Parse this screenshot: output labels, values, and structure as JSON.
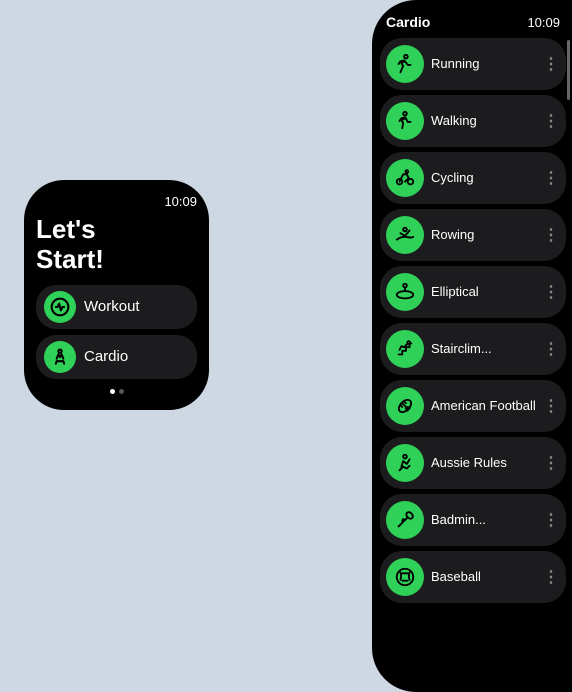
{
  "background_color": "#cdd8e3",
  "small_watch": {
    "time": "10:09",
    "title": "Let's\nStart!",
    "menu_items": [
      {
        "id": "workout",
        "label": "Workout",
        "icon": "🏋️"
      },
      {
        "id": "cardio",
        "label": "Cardio",
        "icon": "🏃"
      }
    ],
    "dots": [
      true,
      false
    ]
  },
  "large_watch": {
    "header_title": "Cardio",
    "time": "10:09",
    "list_items": [
      {
        "id": "running",
        "label": "Running",
        "icon": "🏃"
      },
      {
        "id": "walking",
        "label": "Walking",
        "icon": "🚶"
      },
      {
        "id": "cycling",
        "label": "Cycling",
        "icon": "🚴"
      },
      {
        "id": "rowing",
        "label": "Rowing",
        "icon": "🚣"
      },
      {
        "id": "elliptical",
        "label": "Elliptical",
        "icon": "🏃"
      },
      {
        "id": "stairclimber",
        "label": "Stairclim...",
        "icon": "🧗"
      },
      {
        "id": "american-football",
        "label": "American Football",
        "icon": "🏈"
      },
      {
        "id": "aussie-rules",
        "label": "Aussie Rules",
        "icon": "🏃"
      },
      {
        "id": "badminton",
        "label": "Badmin...",
        "icon": "🏸"
      },
      {
        "id": "baseball",
        "label": "Baseball",
        "icon": "⚾"
      }
    ]
  },
  "icons": {
    "running": "🏃",
    "walking": "🚶",
    "cycling": "🚴",
    "rowing": "🚣",
    "elliptical": "〰",
    "stairclimber": "🪜",
    "american_football": "🏈",
    "aussie_rules": "🏃",
    "badminton": "🏸",
    "baseball": "⚾",
    "workout": "🏋",
    "cardio": "🏃",
    "more_dots": "⋮"
  }
}
